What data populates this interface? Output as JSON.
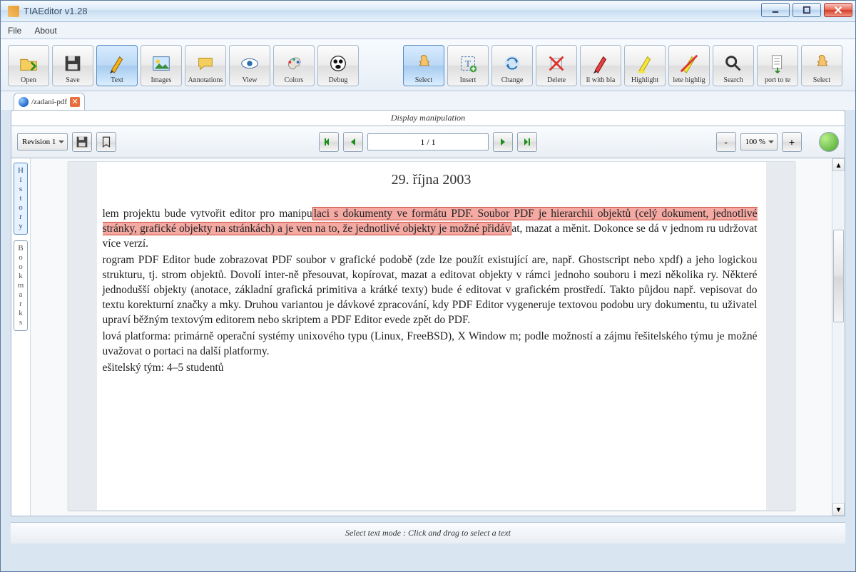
{
  "window": {
    "title": "TIAEditor v1.28"
  },
  "menu": {
    "file": "File",
    "about": "About"
  },
  "toolbar_main": [
    {
      "id": "open",
      "label": "Open"
    },
    {
      "id": "save",
      "label": "Save"
    },
    {
      "id": "text",
      "label": "Text",
      "active": true
    },
    {
      "id": "images",
      "label": "Images"
    },
    {
      "id": "annotations",
      "label": "Annotations"
    },
    {
      "id": "view",
      "label": "View"
    },
    {
      "id": "colors",
      "label": "Colors"
    },
    {
      "id": "debug",
      "label": "Debug"
    }
  ],
  "toolbar_edit": [
    {
      "id": "select",
      "label": "Select",
      "active": true
    },
    {
      "id": "insert",
      "label": "Insert"
    },
    {
      "id": "change",
      "label": "Change"
    },
    {
      "id": "delete",
      "label": "Delete"
    },
    {
      "id": "fillwithblank",
      "label": "ll with bla"
    },
    {
      "id": "highlight",
      "label": "Highlight"
    },
    {
      "id": "deletehighlight",
      "label": "lete highlig"
    },
    {
      "id": "search",
      "label": "Search"
    },
    {
      "id": "exporttotext",
      "label": "port to te"
    },
    {
      "id": "select2",
      "label": "Select"
    }
  ],
  "tab": {
    "name": "/zadani-pdf"
  },
  "display_header": "Display manipulation",
  "controls": {
    "revision": "Revision 1",
    "page_display": "1 / 1",
    "zoom": "100 %",
    "minus": "-",
    "plus": "+"
  },
  "side": {
    "history": [
      "H",
      "i",
      "s",
      "t",
      "o",
      "r",
      "y"
    ],
    "bookmarks": [
      "B",
      "o",
      "o",
      "k",
      "m",
      "a",
      "r",
      "k",
      "s"
    ]
  },
  "document": {
    "date": "29. října 2003",
    "p1_pre": "lem projektu bude vytvořit editor pro manipu",
    "p1_hl": "laci s dokumenty ve formátu PDF. Soubor PDF je hierarchii objektů (celý dokument, jednotlivé stránky, grafické objekty na stránkách) a je ven na to, že jednotlivé objekty je možné přidáv",
    "p1_post": "at, mazat a měnit. Dokonce se dá v jednom ru udržovat více verzí.",
    "p2": "rogram PDF Editor bude zobrazovat PDF soubor v grafické podobě (zde lze použít existující are, např. Ghostscript nebo xpdf) a jeho logickou strukturu, tj. strom objektů. Dovolí inter-ně přesouvat, kopírovat, mazat a editovat objekty v rámci jednoho souboru i mezi několika ry. Některé jednodušší objekty (anotace, základní grafická primitiva a krátké texty) bude é editovat v grafickém prostředí. Takto půjdou např. vepisovat do textu korekturní značky a mky. Druhou variantou je dávkové zpracování, kdy PDF Editor vygeneruje textovou podobu ury dokumentu, tu uživatel upraví běžným textovým editorem nebo skriptem a PDF Editor evede zpět do PDF.",
    "p3": "lová platforma: primárně operační systémy unixového typu (Linux, FreeBSD), X Window m; podle možností a zájmu řešitelského týmu je možné uvažovat o portaci na další platformy.",
    "p4": "ešitelský tým: 4–5 studentů"
  },
  "status": "Select text mode : Click and drag to select a text"
}
